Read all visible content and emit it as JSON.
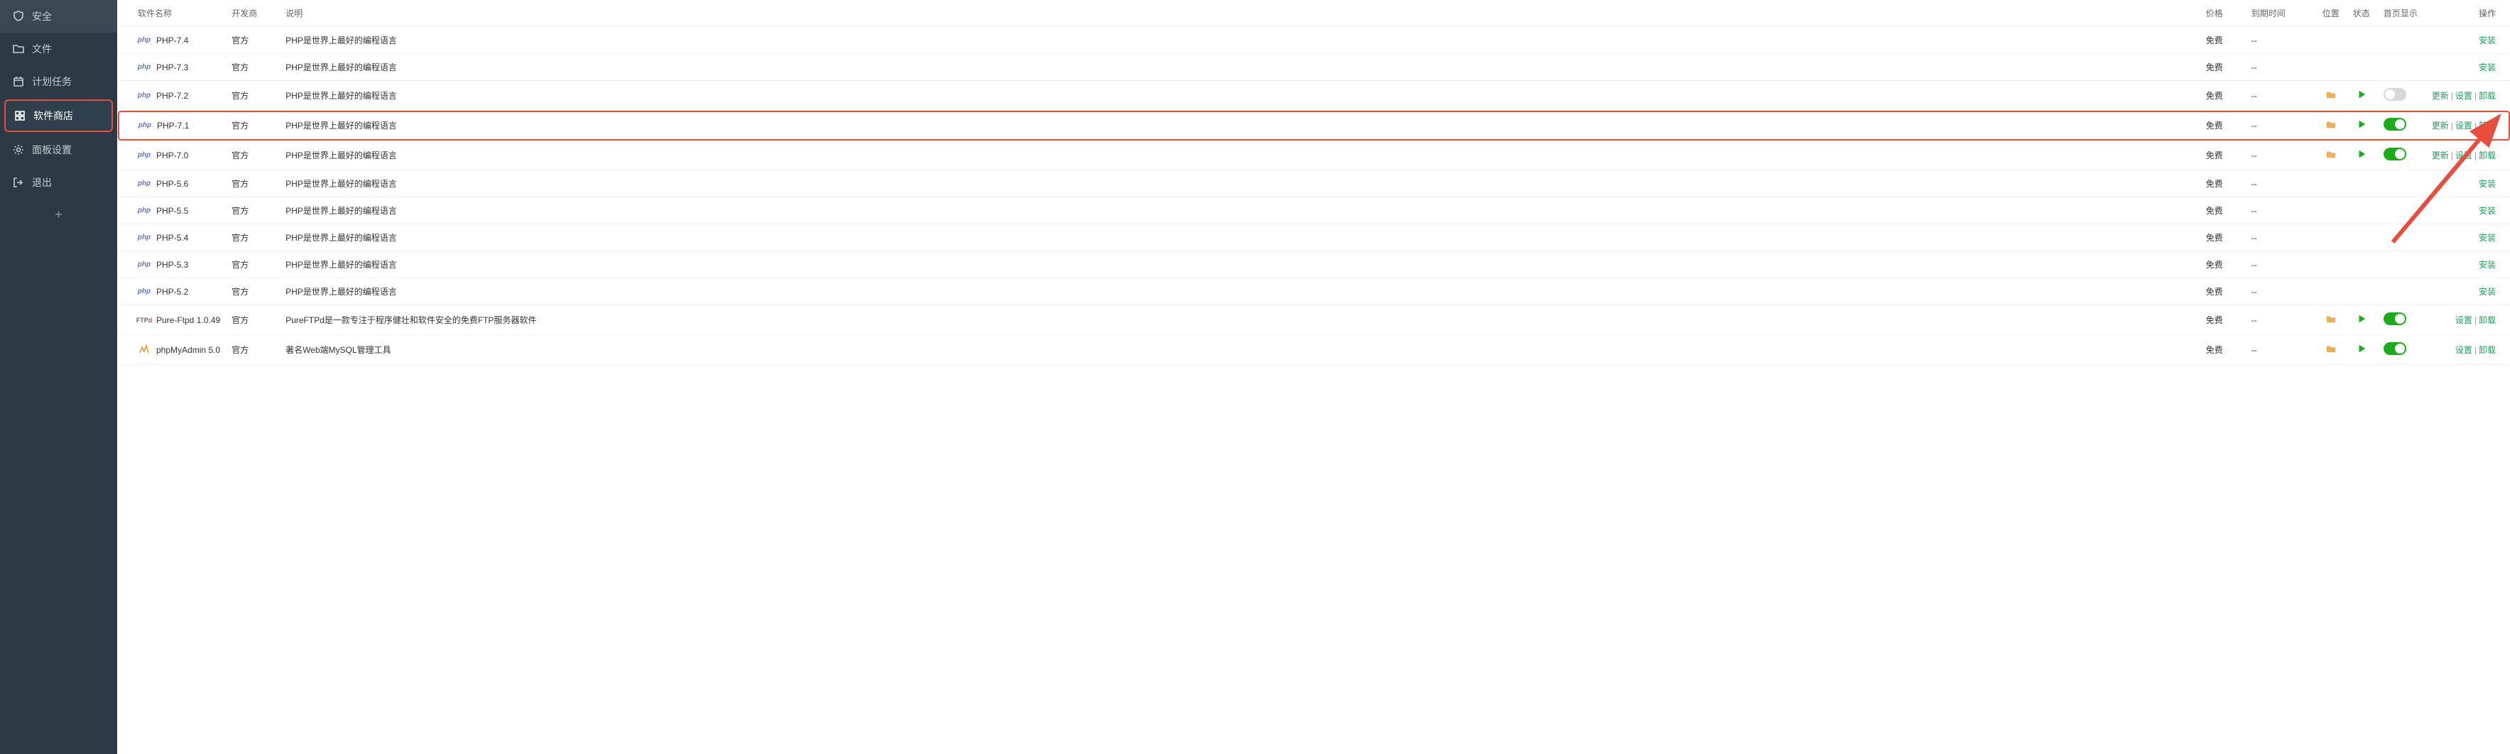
{
  "sidebar": {
    "items": [
      {
        "label": "安全",
        "icon": "shield",
        "active": false
      },
      {
        "label": "文件",
        "icon": "folder",
        "active": false
      },
      {
        "label": "计划任务",
        "icon": "calendar",
        "active": false
      },
      {
        "label": "软件商店",
        "icon": "grid",
        "active": true
      },
      {
        "label": "面板设置",
        "icon": "gear",
        "active": false
      },
      {
        "label": "退出",
        "icon": "exit",
        "active": false
      }
    ],
    "add": "+"
  },
  "table": {
    "headers": {
      "name": "软件名称",
      "developer": "开发商",
      "desc": "说明",
      "price": "价格",
      "expire": "到期时间",
      "location": "位置",
      "status": "状态",
      "home_display": "首页显示",
      "op": "操作"
    },
    "rows": [
      {
        "logo": "php",
        "name": "PHP-7.4",
        "dev": "官方",
        "desc": "PHP是世界上最好的编程语言",
        "price": "免费",
        "expire": "--",
        "loc": null,
        "status": null,
        "toggle": null,
        "actions": [
          "安装"
        ]
      },
      {
        "logo": "php",
        "name": "PHP-7.3",
        "dev": "官方",
        "desc": "PHP是世界上最好的编程语言",
        "price": "免费",
        "expire": "--",
        "loc": null,
        "status": null,
        "toggle": null,
        "actions": [
          "安装"
        ]
      },
      {
        "logo": "php",
        "name": "PHP-7.2",
        "dev": "官方",
        "desc": "PHP是世界上最好的编程语言",
        "price": "免费",
        "expire": "--",
        "loc": "folder",
        "status": "play",
        "toggle": "off",
        "actions": [
          "更新",
          "设置",
          "卸载"
        ]
      },
      {
        "logo": "php",
        "name": "PHP-7.1",
        "dev": "官方",
        "desc": "PHP是世界上最好的编程语言",
        "price": "免费",
        "expire": "--",
        "loc": "folder",
        "status": "play",
        "toggle": "on",
        "actions": [
          "更新",
          "设置",
          "卸载"
        ],
        "highlighted": true
      },
      {
        "logo": "php",
        "name": "PHP-7.0",
        "dev": "官方",
        "desc": "PHP是世界上最好的编程语言",
        "price": "免费",
        "expire": "--",
        "loc": "folder",
        "status": "play",
        "toggle": "on",
        "actions": [
          "更新",
          "设置",
          "卸载"
        ]
      },
      {
        "logo": "php",
        "name": "PHP-5.6",
        "dev": "官方",
        "desc": "PHP是世界上最好的编程语言",
        "price": "免费",
        "expire": "--",
        "loc": null,
        "status": null,
        "toggle": null,
        "actions": [
          "安装"
        ]
      },
      {
        "logo": "php",
        "name": "PHP-5.5",
        "dev": "官方",
        "desc": "PHP是世界上最好的编程语言",
        "price": "免费",
        "expire": "--",
        "loc": null,
        "status": null,
        "toggle": null,
        "actions": [
          "安装"
        ]
      },
      {
        "logo": "php",
        "name": "PHP-5.4",
        "dev": "官方",
        "desc": "PHP是世界上最好的编程语言",
        "price": "免费",
        "expire": "--",
        "loc": null,
        "status": null,
        "toggle": null,
        "actions": [
          "安装"
        ]
      },
      {
        "logo": "php",
        "name": "PHP-5.3",
        "dev": "官方",
        "desc": "PHP是世界上最好的编程语言",
        "price": "免费",
        "expire": "--",
        "loc": null,
        "status": null,
        "toggle": null,
        "actions": [
          "安装"
        ]
      },
      {
        "logo": "php",
        "name": "PHP-5.2",
        "dev": "官方",
        "desc": "PHP是世界上最好的编程语言",
        "price": "免费",
        "expire": "--",
        "loc": null,
        "status": null,
        "toggle": null,
        "actions": [
          "安装"
        ]
      },
      {
        "logo": "ftp",
        "name": "Pure-Ftpd 1.0.49",
        "dev": "官方",
        "desc": "PureFTPd是一款专注于程序健壮和软件安全的免费FTP服务器软件",
        "price": "免费",
        "expire": "--",
        "loc": "folder",
        "status": "play",
        "toggle": "on",
        "actions": [
          "设置",
          "卸载"
        ]
      },
      {
        "logo": "pma",
        "name": "phpMyAdmin 5.0",
        "dev": "官方",
        "desc": "著名Web端MySQL管理工具",
        "price": "免费",
        "expire": "--",
        "loc": "folder",
        "status": "play",
        "toggle": "on",
        "actions": [
          "设置",
          "卸载"
        ]
      }
    ]
  }
}
